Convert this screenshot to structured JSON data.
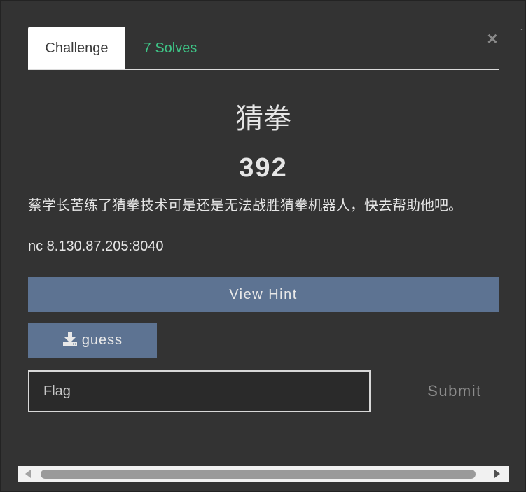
{
  "modal": {
    "close_label": "×",
    "corner_mark": "ˇ"
  },
  "tabs": [
    {
      "label": "Challenge",
      "active": true
    },
    {
      "label": "7 Solves",
      "active": false
    }
  ],
  "challenge": {
    "name": "猜拳",
    "value": "392",
    "description": "蔡学长苦练了猜拳技术可是还是无法战胜猜拳机器人，快去帮助他吧。",
    "connection": "nc 8.130.87.205:8040"
  },
  "buttons": {
    "view_hint": "View Hint",
    "file": "guess",
    "file_icon": "download-icon",
    "submit": "Submit"
  },
  "flag": {
    "placeholder": "Flag",
    "value": ""
  },
  "colors": {
    "background": "#333333",
    "button": "#5d7392",
    "solves_tab": "#3ec486",
    "text": "#e6e6e6"
  }
}
